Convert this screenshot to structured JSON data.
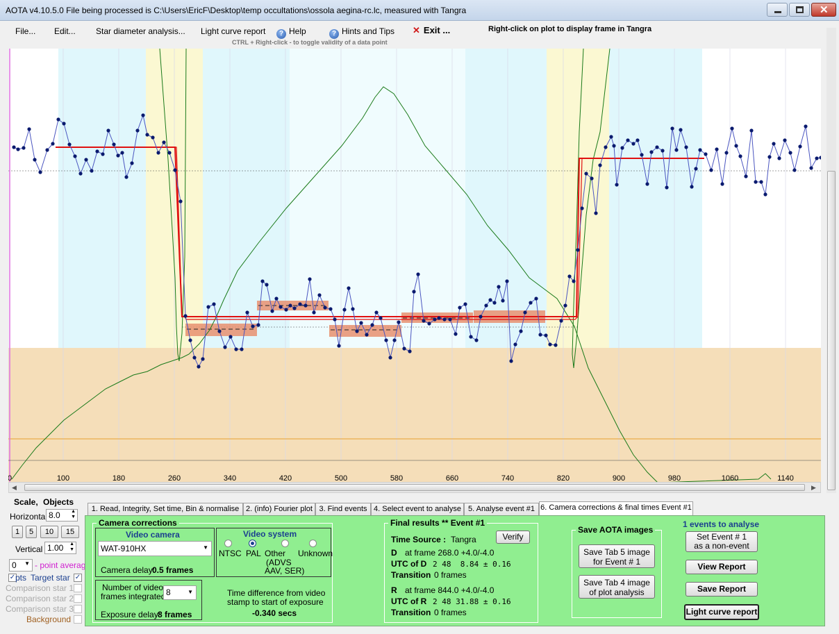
{
  "window": {
    "title": "AOTA v4.10.5.0   File being processed is C:\\Users\\EricF\\Desktop\\temp occultations\\ossola aegina-rc.lc, measured with Tangra"
  },
  "menu": {
    "file": "File...",
    "edit": "Edit...",
    "star_diameter": "Star diameter analysis...",
    "light_curve_report": "Light curve report",
    "help": "Help",
    "hints": "Hints and Tips",
    "exit": "Exit ...",
    "right_click_hint": "Right-click on plot to display frame in Tangra",
    "ctrl_hint": "CTRL + Right-click  -  to toggle validity of a data point"
  },
  "chart_data": {
    "type": "line",
    "x_ticks": [
      "0",
      "100",
      "180",
      "260",
      "340",
      "420",
      "500",
      "580",
      "660",
      "740",
      "820",
      "900",
      "980",
      "1060",
      "1140"
    ],
    "xlim": [
      0,
      1170
    ],
    "series": [
      {
        "values": [
          [
            5,
            620
          ],
          [
            20,
            600
          ],
          [
            40,
            575
          ],
          [
            60,
            555
          ],
          [
            80,
            535
          ],
          [
            100,
            520
          ],
          [
            120,
            505
          ],
          [
            140,
            490
          ],
          [
            160,
            480
          ],
          [
            180,
            470
          ],
          [
            200,
            465
          ],
          [
            220,
            455
          ],
          [
            235,
            450
          ],
          [
            250,
            445
          ],
          [
            260,
            440
          ],
          [
            275,
            425
          ],
          [
            290,
            405
          ],
          [
            300,
            385
          ],
          [
            310,
            362
          ],
          [
            330,
            320
          ],
          [
            360,
            280
          ],
          [
            400,
            230
          ],
          [
            440,
            185
          ],
          [
            480,
            140
          ],
          [
            510,
            100
          ],
          [
            528,
            70
          ],
          [
            540,
            55
          ],
          [
            555,
            65
          ],
          [
            575,
            95
          ],
          [
            600,
            140
          ],
          [
            630,
            175
          ],
          [
            660,
            210
          ],
          [
            690,
            255
          ],
          [
            720,
            290
          ],
          [
            750,
            330
          ],
          [
            770,
            345
          ],
          [
            790,
            360
          ],
          [
            815,
            400
          ],
          [
            835,
            460
          ],
          [
            860,
            510
          ],
          [
            880,
            550
          ],
          [
            900,
            585
          ],
          [
            920,
            610
          ],
          [
            935,
            625
          ],
          [
            1080,
            620
          ],
          [
            1090,
            612
          ],
          [
            1098,
            620
          ]
        ]
      }
    ],
    "target_points": [
      [
        8,
        142
      ],
      [
        14,
        145
      ],
      [
        22,
        143
      ],
      [
        30,
        116
      ],
      [
        38,
        160
      ],
      [
        46,
        178
      ],
      [
        56,
        146
      ],
      [
        64,
        137
      ],
      [
        72,
        102
      ],
      [
        80,
        108
      ],
      [
        88,
        138
      ],
      [
        96,
        155
      ],
      [
        104,
        180
      ],
      [
        112,
        160
      ],
      [
        120,
        176
      ],
      [
        128,
        148
      ],
      [
        136,
        152
      ],
      [
        144,
        118
      ],
      [
        152,
        138
      ],
      [
        158,
        154
      ],
      [
        164,
        150
      ],
      [
        170,
        185
      ],
      [
        178,
        165
      ],
      [
        186,
        118
      ],
      [
        194,
        96
      ],
      [
        200,
        124
      ],
      [
        208,
        128
      ],
      [
        216,
        150
      ],
      [
        224,
        135
      ],
      [
        232,
        150
      ],
      [
        240,
        175
      ],
      [
        248,
        220
      ],
      [
        255,
        385
      ],
      [
        262,
        420
      ],
      [
        268,
        445
      ],
      [
        274,
        458
      ],
      [
        280,
        447
      ],
      [
        288,
        372
      ],
      [
        296,
        368
      ],
      [
        304,
        407
      ],
      [
        312,
        430
      ],
      [
        320,
        415
      ],
      [
        328,
        433
      ],
      [
        336,
        433
      ],
      [
        344,
        380
      ],
      [
        352,
        400
      ],
      [
        360,
        398
      ],
      [
        366,
        335
      ],
      [
        372,
        340
      ],
      [
        380,
        378
      ],
      [
        386,
        360
      ],
      [
        392,
        372
      ],
      [
        400,
        376
      ],
      [
        406,
        370
      ],
      [
        412,
        374
      ],
      [
        420,
        368
      ],
      [
        428,
        370
      ],
      [
        434,
        332
      ],
      [
        440,
        380
      ],
      [
        448,
        355
      ],
      [
        456,
        373
      ],
      [
        464,
        375
      ],
      [
        470,
        390
      ],
      [
        476,
        428
      ],
      [
        484,
        376
      ],
      [
        490,
        345
      ],
      [
        496,
        375
      ],
      [
        502,
        407
      ],
      [
        508,
        395
      ],
      [
        516,
        412
      ],
      [
        524,
        398
      ],
      [
        530,
        380
      ],
      [
        536,
        388
      ],
      [
        544,
        420
      ],
      [
        550,
        445
      ],
      [
        556,
        420
      ],
      [
        562,
        394
      ],
      [
        570,
        432
      ],
      [
        578,
        436
      ],
      [
        584,
        350
      ],
      [
        590,
        325
      ],
      [
        598,
        392
      ],
      [
        606,
        396
      ],
      [
        614,
        390
      ],
      [
        620,
        388
      ],
      [
        628,
        390
      ],
      [
        636,
        390
      ],
      [
        644,
        411
      ],
      [
        650,
        373
      ],
      [
        658,
        368
      ],
      [
        666,
        415
      ],
      [
        674,
        420
      ],
      [
        680,
        386
      ],
      [
        688,
        370
      ],
      [
        694,
        362
      ],
      [
        700,
        366
      ],
      [
        706,
        343
      ],
      [
        712,
        363
      ],
      [
        718,
        335
      ],
      [
        724,
        450
      ],
      [
        730,
        426
      ],
      [
        738,
        407
      ],
      [
        744,
        380
      ],
      [
        752,
        366
      ],
      [
        760,
        360
      ],
      [
        766,
        412
      ],
      [
        774,
        413
      ],
      [
        780,
        426
      ],
      [
        788,
        427
      ],
      [
        796,
        392
      ],
      [
        802,
        370
      ],
      [
        808,
        328
      ],
      [
        814,
        335
      ],
      [
        820,
        290
      ],
      [
        826,
        230
      ],
      [
        832,
        180
      ],
      [
        840,
        187
      ],
      [
        846,
        237
      ],
      [
        852,
        168
      ],
      [
        860,
        142
      ],
      [
        868,
        127
      ],
      [
        872,
        140
      ],
      [
        876,
        196
      ],
      [
        884,
        143
      ],
      [
        892,
        132
      ],
      [
        900,
        137
      ],
      [
        906,
        132
      ],
      [
        912,
        153
      ],
      [
        920,
        195
      ],
      [
        926,
        149
      ],
      [
        934,
        142
      ],
      [
        942,
        147
      ],
      [
        948,
        200
      ],
      [
        956,
        115
      ],
      [
        962,
        146
      ],
      [
        968,
        117
      ],
      [
        976,
        142
      ],
      [
        984,
        199
      ],
      [
        990,
        173
      ],
      [
        996,
        146
      ],
      [
        1004,
        152
      ],
      [
        1012,
        175
      ],
      [
        1020,
        145
      ],
      [
        1028,
        195
      ],
      [
        1034,
        150
      ],
      [
        1042,
        115
      ],
      [
        1048,
        140
      ],
      [
        1054,
        155
      ],
      [
        1062,
        184
      ],
      [
        1070,
        118
      ],
      [
        1076,
        192
      ],
      [
        1084,
        192
      ],
      [
        1090,
        210
      ],
      [
        1096,
        156
      ],
      [
        1102,
        137
      ],
      [
        1110,
        158
      ],
      [
        1118,
        132
      ],
      [
        1126,
        150
      ],
      [
        1132,
        175
      ],
      [
        1140,
        141
      ],
      [
        1148,
        112
      ],
      [
        1156,
        172
      ],
      [
        1164,
        158
      ],
      [
        1170,
        157
      ]
    ],
    "model_fit": {
      "baseline_top": 142,
      "event_bottom": 386,
      "d_frame": 268.0,
      "r_frame": 844.0
    }
  },
  "left_panel": {
    "scale_title": "Scale,",
    "objects_title": "Objects",
    "horizontal_label": "Horizontal",
    "horizontal_value": "8.0",
    "vertical_label": "Vertical",
    "vertical_value": "1.00",
    "zoom_buttons": [
      "1",
      "5",
      "10",
      "15"
    ],
    "point_average_value": "0",
    "point_average_label": "- point average",
    "pts_label": "pts",
    "target_star": "Target star",
    "comparison_1": "Comparison star 1",
    "comparison_2": "Comparison star 2",
    "comparison_3": "Comparison star 3",
    "background": "Background"
  },
  "tabs": [
    "1. Read, Integrity, Set time, Bin & normalise",
    "2. (info)  Fourier plot",
    "3. Find events",
    "4. Select event to analyse",
    "5. Analyse event #1",
    "6. Camera corrections & final times Event #1"
  ],
  "camera": {
    "group_title": "Camera corrections",
    "video_camera_title": "Video camera",
    "camera_value": "WAT-910HX",
    "camera_delay_label": "Camera delay:",
    "camera_delay_value": "0.5 frames",
    "video_system_title": "Video system",
    "ntsc": "NTSC",
    "pal": "PAL",
    "other": "Other",
    "other_sub1": "(ADVS",
    "other_sub2": "AAV, SER)",
    "unknown": "Unknown",
    "frames_integrated_label_1": "Number of video",
    "frames_integrated_label_2": "frames integrated",
    "frames_integrated_value": "8",
    "exposure_delay_label": "Exposure delay:",
    "exposure_delay_value": "8 frames",
    "time_diff_label_1": "Time difference from video",
    "time_diff_label_2": "stamp to start of exposure",
    "time_diff_value": "-0.340 secs"
  },
  "final": {
    "title": "Final results   **   Event #1",
    "time_source_label": "Time Source :",
    "time_source_value": "Tangra",
    "verify": "Verify",
    "d_label": "D",
    "d_frame": "at frame 268.0  +4.0/-4.0",
    "utc_d_label": "UTC of D",
    "utc_d_value": "2 48  8.84 ± 0.16",
    "transition_label": "Transition",
    "transition_d_value": "0 frames",
    "r_label": "R",
    "r_frame": "at frame 844.0  +4.0/-4.0",
    "utc_r_label": "UTC of R",
    "utc_r_value": "2 48 31.88 ± 0.16",
    "transition_r_value": "0 frames"
  },
  "save": {
    "title": "Save AOTA images",
    "tab5_line1": "Save Tab 5 image",
    "tab5_line2": "for Event # 1",
    "tab4_line1": "Save Tab 4 image",
    "tab4_line2": "of plot analysis"
  },
  "events": {
    "title": "1  events to analyse",
    "set_event_line1": "Set Event # 1",
    "set_event_line2": "as a non-event",
    "view_report": "View Report",
    "save_report": "Save Report",
    "light_curve_report": "Light curve report"
  }
}
